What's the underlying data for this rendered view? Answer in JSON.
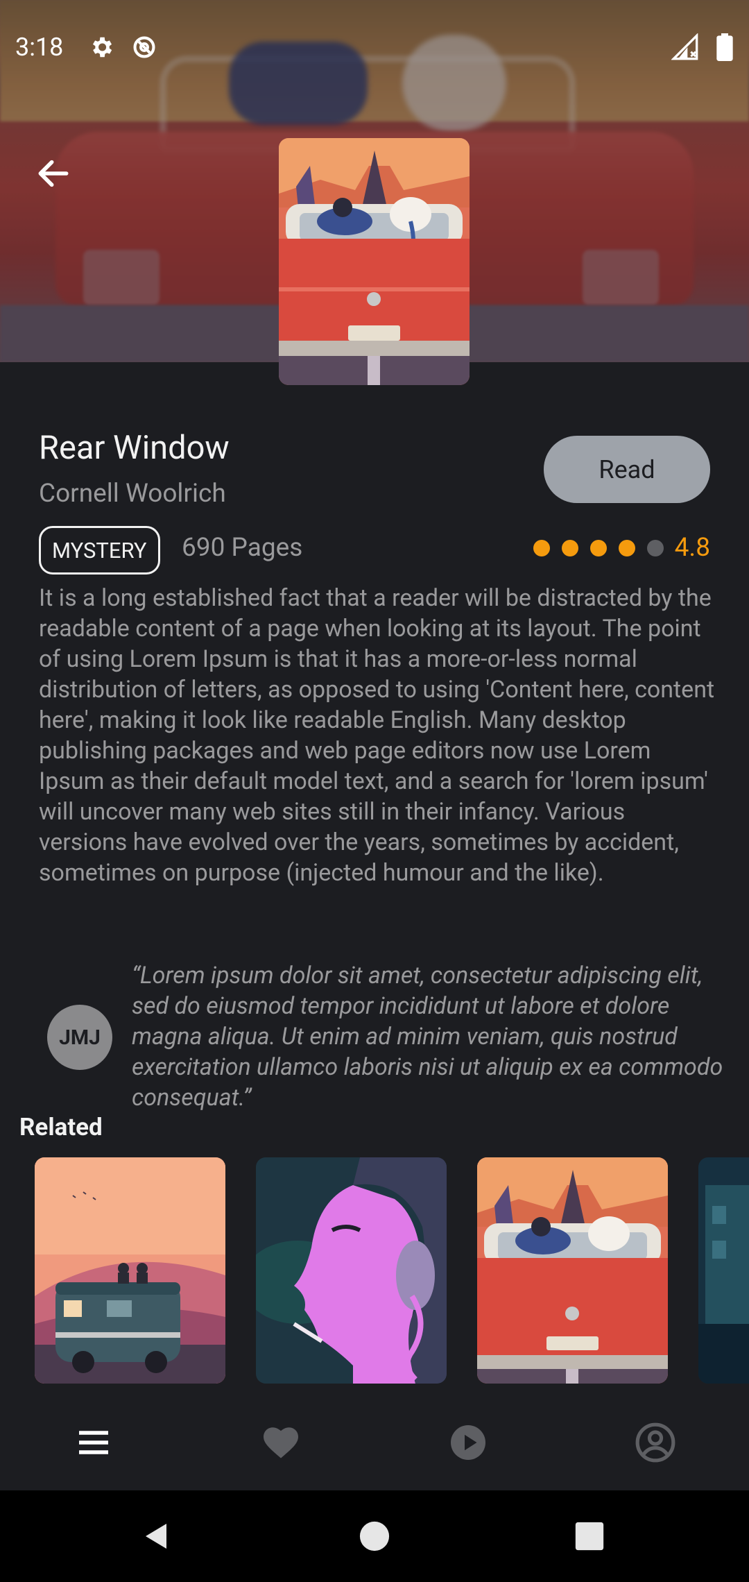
{
  "status_bar": {
    "time": "3:18"
  },
  "book": {
    "title": "Rear Window",
    "author": "Cornell Woolrich",
    "genre": "MYSTERY",
    "pages": "690 Pages",
    "rating": "4.8",
    "rating_dots_filled": 4,
    "rating_dots_total": 5,
    "read_label": "Read",
    "description": "It is a long established fact that a reader will be distracted by the readable content of a page when looking at its layout. The point of using Lorem Ipsum is that it has a more-or-less normal distribution of letters, as opposed to using 'Content here, content here', making it look like readable English. Many desktop publishing packages and web page editors now use Lorem Ipsum as their default model text, and a search for 'lorem ipsum' will uncover many web sites still in their infancy. Various versions have evolved over the years, sometimes by accident, sometimes on purpose (injected humour and the like).",
    "quote": {
      "initials": "JMJ",
      "text": "“Lorem ipsum dolor sit amet, consectetur adipiscing elit, sed do eiusmod tempor incididunt ut labore et dolore magna aliqua. Ut enim ad minim veniam, quis nostrud exercitation ullamco laboris nisi ut aliquip ex ea commodo consequat.”"
    }
  },
  "related": {
    "label": "Related"
  },
  "colors": {
    "accent": "#f59b0e",
    "background": "#1c1d21",
    "button": "#9ea3aa",
    "muted_text": "#9a9a9c"
  },
  "icons": {
    "back": "arrow-left-icon",
    "nav": [
      "menu-icon",
      "heart-icon",
      "play-circle-icon",
      "account-circle-icon"
    ],
    "system": [
      "back-triangle-icon",
      "home-circle-icon",
      "recents-square-icon"
    ]
  }
}
